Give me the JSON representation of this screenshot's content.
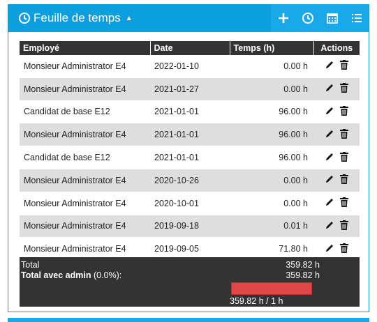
{
  "header": {
    "title": "Feuille de temps",
    "toolbar": [
      "add-icon",
      "timer-icon",
      "calendar-icon",
      "list-icon"
    ]
  },
  "table": {
    "columns": [
      "Employé",
      "Date",
      "Temps (h)",
      "Actions"
    ],
    "rows": [
      {
        "employee": "Monsieur Administrator E4",
        "date": "2022-01-10",
        "time": "0.00 h"
      },
      {
        "employee": "Monsieur Administrator E4",
        "date": "2021-01-27",
        "time": "0.00 h"
      },
      {
        "employee": "Candidat de base E12",
        "date": "2021-01-01",
        "time": "96.00 h"
      },
      {
        "employee": "Monsieur Administrator E4",
        "date": "2021-01-01",
        "time": "96.00 h"
      },
      {
        "employee": "Candidat de base E12",
        "date": "2021-01-01",
        "time": "96.00 h"
      },
      {
        "employee": "Monsieur Administrator E4",
        "date": "2020-10-26",
        "time": "0.00 h"
      },
      {
        "employee": "Monsieur Administrator E4",
        "date": "2020-10-01",
        "time": "0.00 h"
      },
      {
        "employee": "Monsieur Administrator E4",
        "date": "2019-09-18",
        "time": "0.01 h"
      },
      {
        "employee": "Monsieur Administrator E4",
        "date": "2019-09-05",
        "time": "71.80 h"
      }
    ]
  },
  "totals": {
    "total_label": "Total",
    "total_value": "359.82 h",
    "admin_label": "Total avec admin",
    "admin_pct": "(0.0%):",
    "admin_value": "359.82 h",
    "progress_label": "359.82 h / 1 h",
    "progress_fraction": 1.0
  },
  "colors": {
    "header": "#0b9fdd",
    "toolbar": "#1aa9e8",
    "table_head": "#333333",
    "row_alt": "#dedede",
    "progress": "#e04848"
  }
}
